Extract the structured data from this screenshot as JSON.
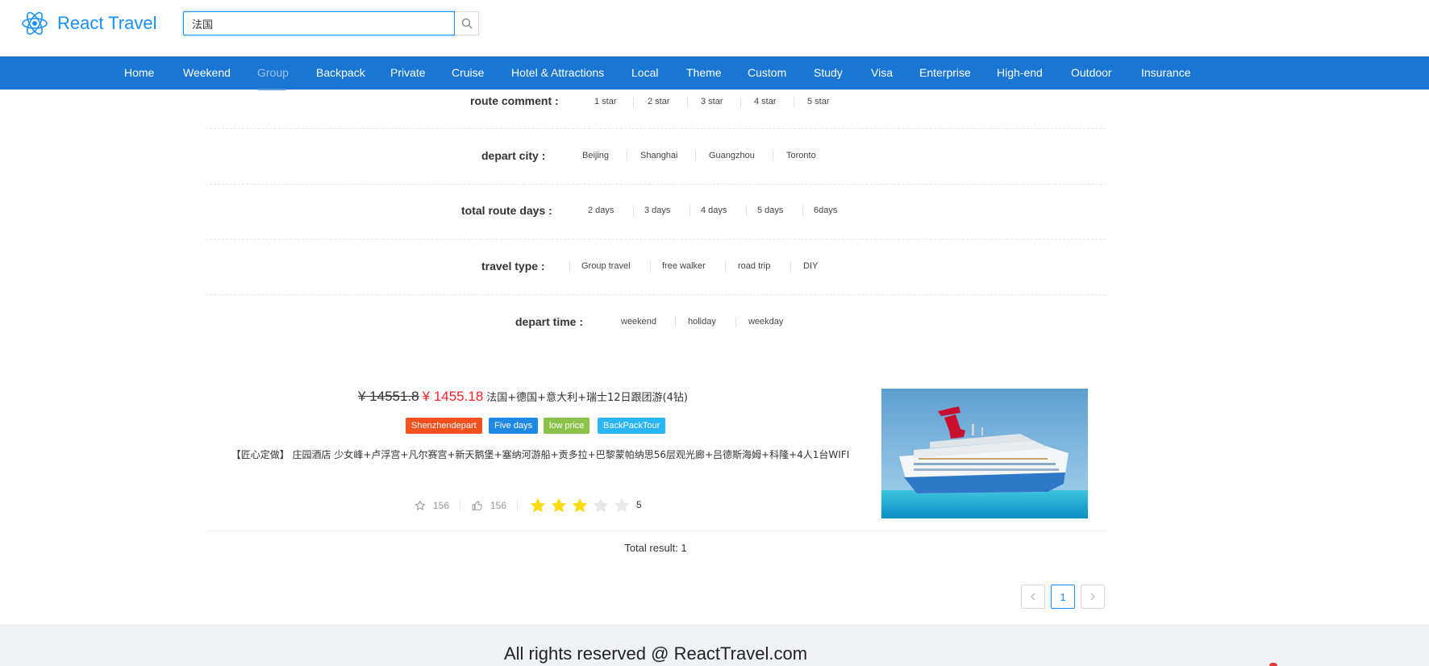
{
  "header": {
    "brand": "React Travel",
    "logo_icon": "react-logo-icon",
    "search": {
      "value": "法国",
      "placeholder": ""
    },
    "search_icon": "search-icon"
  },
  "nav": {
    "items": [
      "Home",
      "Weekend",
      "Group",
      "Backpack",
      "Private",
      "Cruise",
      "Hotel & Attractions",
      "Local",
      "Theme",
      "Custom",
      "Study",
      "Visa",
      "Enterprise",
      "High-end",
      "Outdoor",
      "Insurance"
    ],
    "active": "Group"
  },
  "filters": [
    {
      "label": "route comment :",
      "options": [
        "1 star",
        "2 star",
        "3 star",
        "4 star",
        "5 star"
      ]
    },
    {
      "label": "depart city :",
      "options": [
        "Beijing",
        "Shanghai",
        "Guangzhou",
        "Toronto"
      ]
    },
    {
      "label": "total route days :",
      "options": [
        "2 days",
        "3 days",
        "4 days",
        "5 days",
        "6days"
      ]
    },
    {
      "label": "travel type :",
      "options": [
        "Group travel",
        "free walker",
        "road trip",
        "DIY"
      ]
    },
    {
      "label": "depart time :",
      "options": [
        "weekend",
        "holiday",
        "weekday"
      ]
    }
  ],
  "product": {
    "original_price": "¥ 14551.8",
    "price": "¥ 1455.18",
    "title": "法国+德国+意大利+瑞士12日跟团游(4钻)",
    "tags": [
      {
        "label": "Shenzhendepart",
        "color": "#f4511e"
      },
      {
        "label": "Five days",
        "color": "#1e88e5"
      },
      {
        "label": "low price",
        "color": "#8bc34a"
      },
      {
        "label": "BackPackTour",
        "color": "#29b6f6"
      }
    ],
    "description": "【匠心定做】 庄园酒店 少女峰+卢浮宫+凡尔赛宫+新天鹅堡+塞纳河游船+贡多拉+巴黎蒙帕纳思56层观光廊+吕德斯海姆+科隆+4人1台WIFI",
    "favorites": "156",
    "likes": "156",
    "rating": 3,
    "rating_max": 5,
    "rating_text": "5",
    "star_color": "#fadb14",
    "image_alt": "cruise ship"
  },
  "results": {
    "total_text": "Total result: 1"
  },
  "pagination": {
    "current": "1",
    "prev_icon": "chevron-left-icon",
    "next_icon": "chevron-right-icon"
  },
  "footer": {
    "text": "All rights reserved @ ReactTravel.com"
  },
  "colors": {
    "accent": "#1890ff",
    "nav_bg": "#1976d2",
    "price_red": "#f5222d"
  }
}
